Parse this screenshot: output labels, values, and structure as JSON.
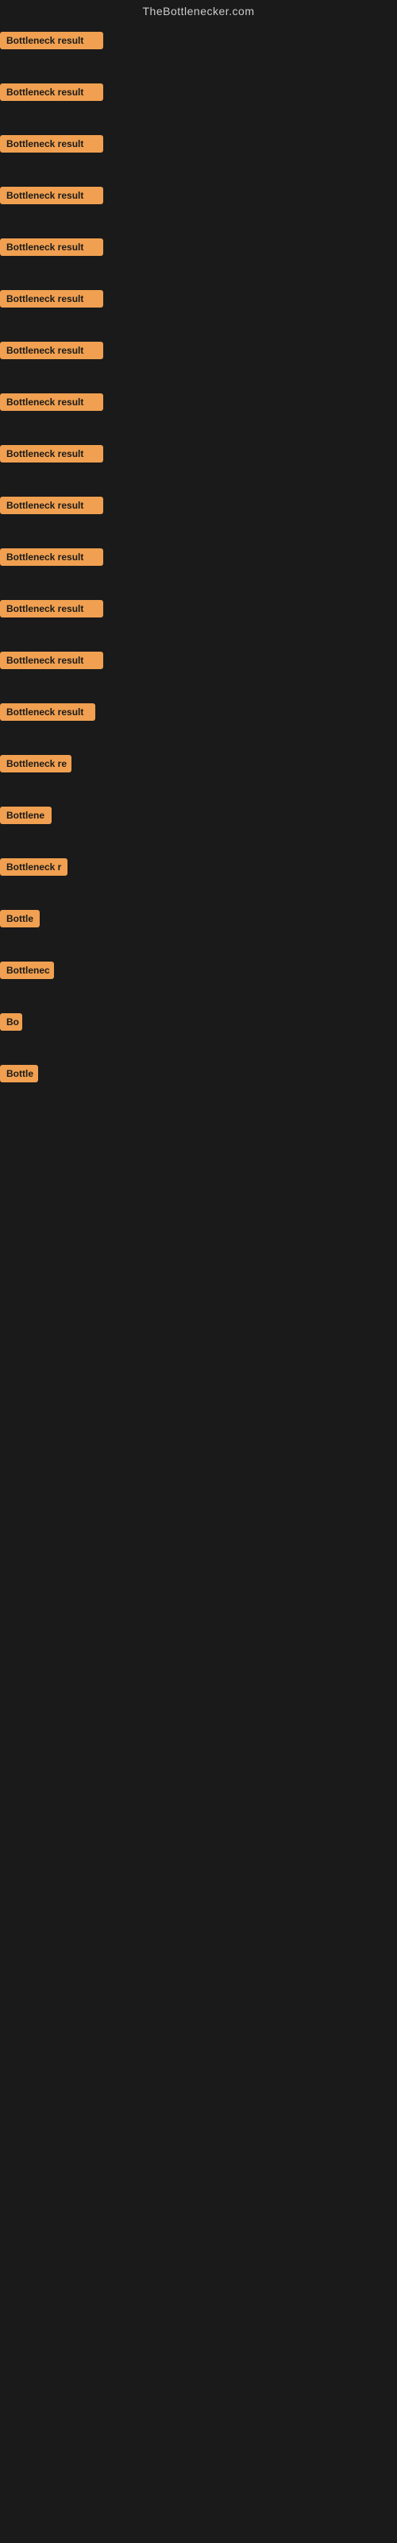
{
  "site": {
    "title": "TheBottlenecker.com"
  },
  "badges": [
    {
      "id": 1,
      "label": "Bottleneck result",
      "width": "full"
    },
    {
      "id": 2,
      "label": "Bottleneck result",
      "width": "full"
    },
    {
      "id": 3,
      "label": "Bottleneck result",
      "width": "full"
    },
    {
      "id": 4,
      "label": "Bottleneck result",
      "width": "full"
    },
    {
      "id": 5,
      "label": "Bottleneck result",
      "width": "full"
    },
    {
      "id": 6,
      "label": "Bottleneck result",
      "width": "full"
    },
    {
      "id": 7,
      "label": "Bottleneck result",
      "width": "full"
    },
    {
      "id": 8,
      "label": "Bottleneck result",
      "width": "full"
    },
    {
      "id": 9,
      "label": "Bottleneck result",
      "width": "full"
    },
    {
      "id": 10,
      "label": "Bottleneck result",
      "width": "full"
    },
    {
      "id": 11,
      "label": "Bottleneck result",
      "width": "full"
    },
    {
      "id": 12,
      "label": "Bottleneck result",
      "width": "full"
    },
    {
      "id": 13,
      "label": "Bottleneck result",
      "width": "full"
    },
    {
      "id": 14,
      "label": "Bottleneck result",
      "width": "truncated-lg"
    },
    {
      "id": 15,
      "label": "Bottleneck re",
      "width": "truncated-md"
    },
    {
      "id": 16,
      "label": "Bottlene",
      "width": "truncated-sm"
    },
    {
      "id": 17,
      "label": "Bottleneck r",
      "width": "truncated-md2"
    },
    {
      "id": 18,
      "label": "Bottle",
      "width": "truncated-xs"
    },
    {
      "id": 19,
      "label": "Bottlenec",
      "width": "truncated-sm2"
    },
    {
      "id": 20,
      "label": "Bo",
      "width": "truncated-xxs"
    },
    {
      "id": 21,
      "label": "Bottle",
      "width": "truncated-xs2"
    }
  ],
  "badge_widths": {
    "full": 130,
    "truncated-lg": 120,
    "truncated-md": 90,
    "truncated-sm": 65,
    "truncated-md2": 85,
    "truncated-xs": 50,
    "truncated-sm2": 68,
    "truncated-xxs": 28,
    "truncated-xs2": 48
  }
}
